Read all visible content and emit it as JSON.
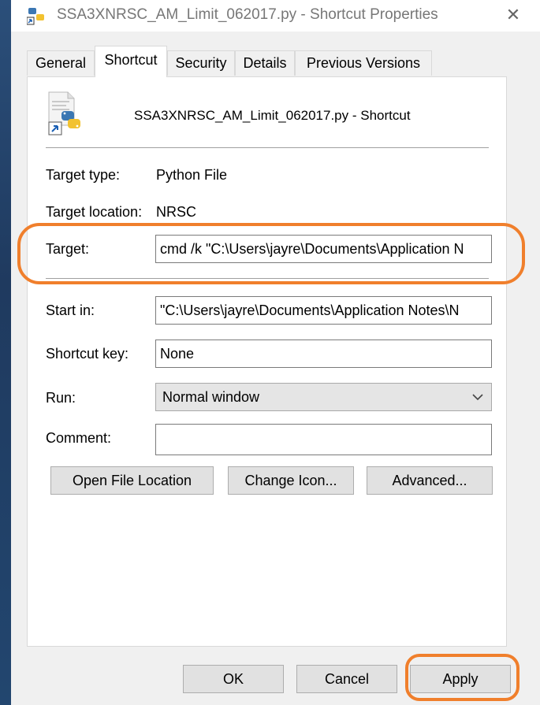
{
  "window": {
    "title": "SSA3XNRSC_AM_Limit_062017.py - Shortcut Properties",
    "close_glyph": "✕"
  },
  "tabs": [
    {
      "label": "General",
      "active": false
    },
    {
      "label": "Shortcut",
      "active": true
    },
    {
      "label": "Security",
      "active": false
    },
    {
      "label": "Details",
      "active": false
    },
    {
      "label": "Previous Versions",
      "active": false
    }
  ],
  "header": {
    "file_name": "SSA3XNRSC_AM_Limit_062017.py - Shortcut",
    "icon": "python-file-icon"
  },
  "properties": {
    "target_type_label": "Target type:",
    "target_type_value": "Python File",
    "target_location_label": "Target location:",
    "target_location_value": "NRSC",
    "target_label": "Target:",
    "target_value": "cmd /k \"C:\\Users\\jayre\\Documents\\Application N",
    "start_in_label": "Start in:",
    "start_in_value": "\"C:\\Users\\jayre\\Documents\\Application Notes\\N",
    "shortcut_key_label": "Shortcut key:",
    "shortcut_key_value": "None",
    "run_label": "Run:",
    "run_value": "Normal window",
    "comment_label": "Comment:",
    "comment_value": ""
  },
  "actions": {
    "open_file_location": "Open File Location",
    "change_icon": "Change Icon...",
    "advanced": "Advanced..."
  },
  "footer": {
    "ok": "OK",
    "cancel": "Cancel",
    "apply": "Apply"
  },
  "colors": {
    "highlight": "#f07f2c",
    "panel_bg": "#ffffff",
    "dialog_bg": "#f0f0f0"
  }
}
